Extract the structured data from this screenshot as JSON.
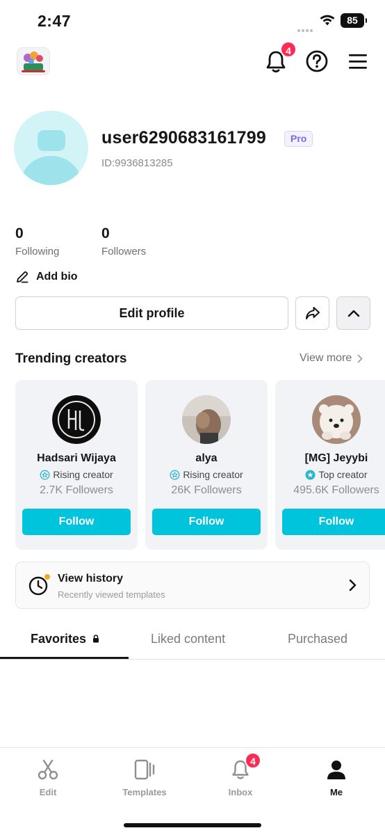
{
  "status_bar": {
    "time": "2:47",
    "battery": "85"
  },
  "header": {
    "notification_count": "4"
  },
  "profile": {
    "username": "user6290683161799",
    "badge": "Pro",
    "id_text": "ID:9936813285",
    "following_count": "0",
    "following_label": "Following",
    "followers_count": "0",
    "followers_label": "Followers",
    "add_bio_label": "Add bio",
    "edit_profile_label": "Edit profile"
  },
  "trending": {
    "title": "Trending creators",
    "view_more": "View more",
    "creators": [
      {
        "name": "Hadsari Wijaya",
        "tag": "Rising creator",
        "followers": "2.7K Followers",
        "follow_label": "Follow"
      },
      {
        "name": "alya",
        "tag": "Rising creator",
        "followers": "26K Followers",
        "follow_label": "Follow"
      },
      {
        "name": "[MG] Jeyybi",
        "tag": "Top creator",
        "followers": "495.6K Followers",
        "follow_label": "Follow"
      }
    ]
  },
  "history": {
    "title": "View history",
    "subtitle": "Recently viewed templates"
  },
  "tabs": [
    {
      "label": "Favorites"
    },
    {
      "label": "Liked content"
    },
    {
      "label": "Purchased"
    }
  ],
  "bottom_nav": [
    {
      "label": "Edit"
    },
    {
      "label": "Templates"
    },
    {
      "label": "Inbox",
      "badge": "4"
    },
    {
      "label": "Me"
    }
  ],
  "colors": {
    "accent": "#00c4dc",
    "badge_red": "#fe2c55",
    "pro_purple": "#7b68ee"
  }
}
